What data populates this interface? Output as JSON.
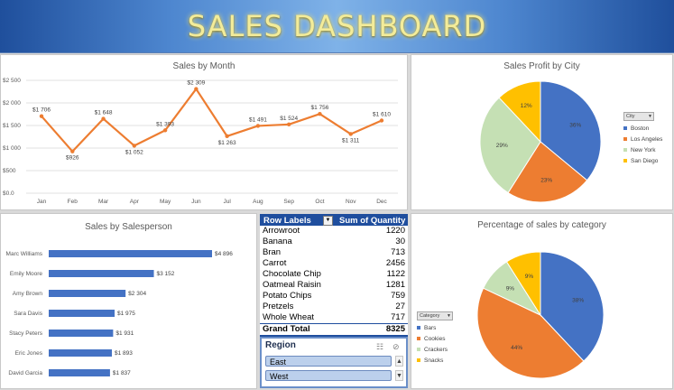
{
  "dashboard": {
    "title": "SALES DASHBOARD"
  },
  "sales_by_month": {
    "chart_data": {
      "type": "line",
      "title": "Sales by Month",
      "categories": [
        "Jan",
        "Feb",
        "Mar",
        "Apr",
        "May",
        "Jun",
        "Jul",
        "Aug",
        "Sep",
        "Oct",
        "Nov",
        "Dec"
      ],
      "values": [
        1706,
        926,
        1648,
        1052,
        1393,
        2309,
        1263,
        1491,
        1524,
        1756,
        1311,
        1610
      ],
      "data_labels": [
        "$1 706",
        "$926",
        "$1 648",
        "$1 052",
        "$1 393",
        "$2 309",
        "$1 263",
        "$1 491",
        "$1 524",
        "$1 756",
        "$1 311",
        "$1 610"
      ],
      "y_ticks": [
        "$2 500",
        "$2 000",
        "$1 500",
        "$1 000",
        "$500",
        "$0.0"
      ],
      "ylim": [
        0,
        2500
      ],
      "grid": true,
      "color": "#ed7d31"
    }
  },
  "profit_by_city": {
    "chart_data": {
      "type": "pie",
      "title": "Sales Profit by City",
      "legend_title": "City",
      "legend_position": "right",
      "labels": [
        "Boston",
        "Los Angeles",
        "New York",
        "San Diego"
      ],
      "values": [
        36,
        23,
        29,
        12
      ],
      "value_labels": [
        "36%",
        "23%",
        "29%",
        "12%"
      ],
      "colors": [
        "#4472c4",
        "#ed7d31",
        "#c5e0b4",
        "#ffc000"
      ]
    }
  },
  "by_salesperson": {
    "chart_data": {
      "type": "bar",
      "orientation": "horizontal",
      "title": "Sales by Salesperson",
      "categories": [
        "Marc Williams",
        "Emily Moore",
        "Amy Brown",
        "Sara Davis",
        "Stacy Peters",
        "Eric Jones",
        "David Garcia"
      ],
      "values": [
        4896,
        3152,
        2304,
        1975,
        1931,
        1893,
        1837
      ],
      "data_labels": [
        "$4 896",
        "$3 152",
        "$2 304",
        "$1 975",
        "$1 931",
        "$1 893",
        "$1 837"
      ],
      "color": "#4472c4"
    }
  },
  "pivot": {
    "header_labels": "Row Labels",
    "header_values": "Sum of Quantity",
    "dropdown_glyph": "▼",
    "rows": [
      {
        "label": "Arrowroot",
        "value": "1220"
      },
      {
        "label": "Banana",
        "value": "30"
      },
      {
        "label": "Bran",
        "value": "713"
      },
      {
        "label": "Carrot",
        "value": "2456"
      },
      {
        "label": "Chocolate Chip",
        "value": "1122"
      },
      {
        "label": "Oatmeal Raisin",
        "value": "1281"
      },
      {
        "label": "Potato Chips",
        "value": "759"
      },
      {
        "label": "Pretzels",
        "value": "27"
      },
      {
        "label": "Whole Wheat",
        "value": "717"
      }
    ],
    "total_label": "Grand Total",
    "total_value": "8325"
  },
  "slicer": {
    "title": "Region",
    "multiselect_icon": "☷",
    "clear_filter_icon": "⊘",
    "items": [
      "East",
      "West"
    ],
    "scroll_up": "▲",
    "scroll_down": "▼"
  },
  "category_pct": {
    "chart_data": {
      "type": "pie",
      "title": "Percentage of sales by category",
      "legend_title": "Category",
      "legend_position": "left",
      "labels": [
        "Bars",
        "Cookies",
        "Crackers",
        "Snacks"
      ],
      "values": [
        38,
        44,
        9,
        9
      ],
      "value_labels": [
        "38%",
        "44%",
        "9%",
        "9%"
      ],
      "colors": [
        "#4472c4",
        "#ed7d31",
        "#c5e0b4",
        "#ffc000"
      ]
    }
  }
}
